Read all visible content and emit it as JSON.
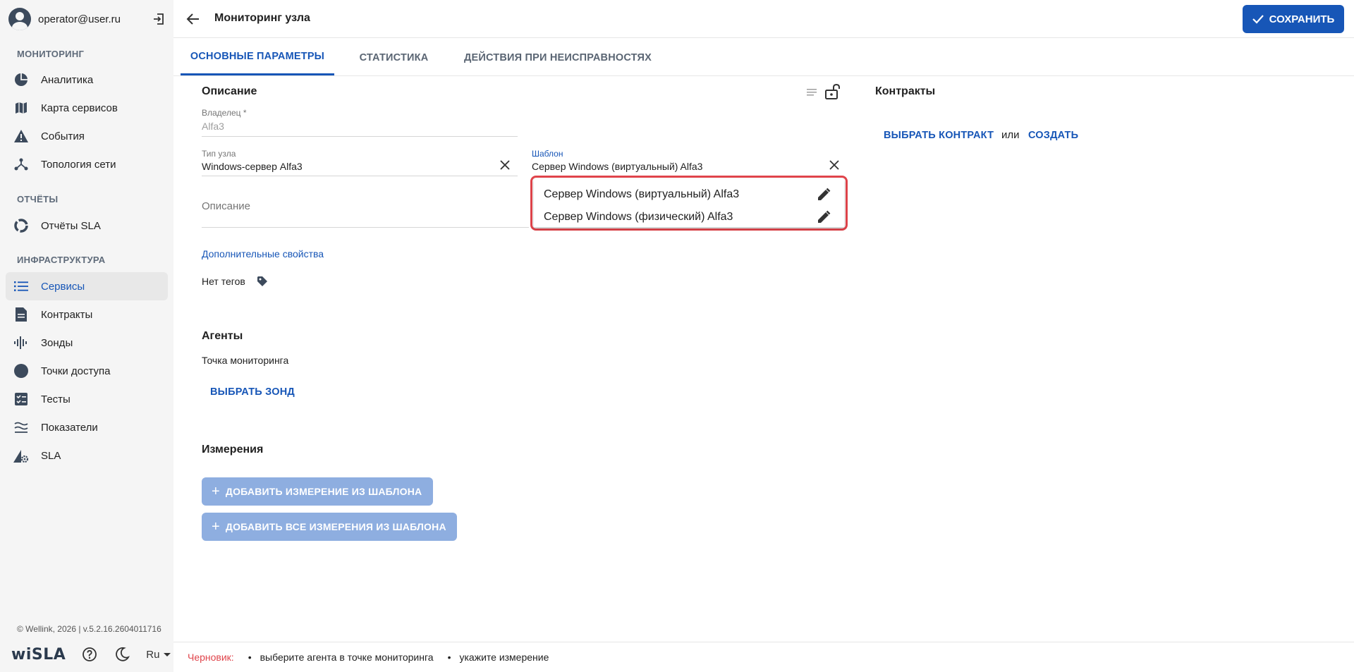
{
  "user": {
    "email": "operator@user.ru"
  },
  "sidebar": {
    "sections": [
      {
        "title": "МОНИТОРИНГ",
        "items": [
          {
            "label": "Аналитика",
            "icon": "pie-chart-icon"
          },
          {
            "label": "Карта сервисов",
            "icon": "map-icon"
          },
          {
            "label": "События",
            "icon": "warning-icon"
          },
          {
            "label": "Топология сети",
            "icon": "topology-icon"
          }
        ]
      },
      {
        "title": "ОТЧЁТЫ",
        "items": [
          {
            "label": "Отчёты SLA",
            "icon": "donut-icon"
          }
        ]
      },
      {
        "title": "ИНФРАСТРУКТУРА",
        "items": [
          {
            "label": "Сервисы",
            "icon": "list-icon",
            "active": true
          },
          {
            "label": "Контракты",
            "icon": "document-icon"
          },
          {
            "label": "Зонды",
            "icon": "waveform-icon"
          },
          {
            "label": "Точки доступа",
            "icon": "circle-icon"
          },
          {
            "label": "Тесты",
            "icon": "checklist-icon"
          },
          {
            "label": "Показатели",
            "icon": "waves-icon"
          },
          {
            "label": "SLA",
            "icon": "sla-gear-icon"
          }
        ]
      }
    ],
    "footer": {
      "copyright": "© Wellink, 2026 | v.5.2.16.2604011716",
      "logo": "wiSLA",
      "lang": "Ru"
    }
  },
  "header": {
    "title": "Мониторинг узла",
    "save_label": "СОХРАНИТЬ"
  },
  "tabs": [
    {
      "label": "ОСНОВНЫЕ ПАРАМЕТРЫ",
      "active": true
    },
    {
      "label": "СТАТИСТИКА"
    },
    {
      "label": "ДЕЙСТВИЯ ПРИ НЕИСПРАВНОСТЯХ"
    }
  ],
  "description_section": {
    "title": "Описание",
    "owner": {
      "label": "Владелец *",
      "value": "Alfa3"
    },
    "node_type": {
      "label": "Тип узла",
      "value": "Windows-сервер Alfa3"
    },
    "template": {
      "label": "Шаблон",
      "value": "Сервер Windows (виртуальный) Alfa3"
    },
    "description": {
      "placeholder": "Описание"
    },
    "extra_props_link": "Дополнительные свойства",
    "tags_text": "Нет тегов"
  },
  "template_dropdown": {
    "options": [
      "Сервер Windows (виртуальный) Alfa3",
      "Сервер Windows (физический) Alfa3"
    ]
  },
  "contracts_section": {
    "title": "Контракты",
    "select_label": "ВЫБРАТЬ КОНТРАКТ",
    "or_text": "или",
    "create_label": "СОЗДАТЬ"
  },
  "agents_section": {
    "title": "Агенты",
    "monitoring_point": "Точка мониторинга",
    "select_probe_label": "ВЫБРАТЬ ЗОНД"
  },
  "measurements_section": {
    "title": "Измерения",
    "add_from_template_label": "ДОБАВИТЬ ИЗМЕРЕНИЕ ИЗ ШАБЛОНА",
    "add_all_label": "ДОБАВИТЬ ВСЕ ИЗМЕРЕНИЯ ИЗ ШАБЛОНА"
  },
  "status_bar": {
    "draft_label": "Черновик:",
    "items": [
      "выберите агента в точке мониторинга",
      "укажите измерение"
    ]
  },
  "colors": {
    "accent": "#1756b7",
    "highlight": "#e0444b",
    "disabled_button": "#8eaee0"
  }
}
